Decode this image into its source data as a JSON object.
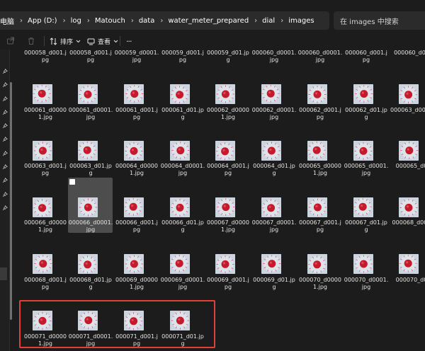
{
  "breadcrumb": [
    "电脑",
    "App (D:)",
    "log",
    "Matouch",
    "data",
    "water_meter_prepared",
    "dial",
    "images"
  ],
  "search_placeholder": "在 images 中搜索",
  "toolbar": {
    "sort_label": "排序",
    "view_label": "查看",
    "more_label": "···"
  },
  "icons": {
    "nav": "chevron-right-icon",
    "share": "share-icon",
    "delete": "trash-icon",
    "sort": "sort-icon",
    "view": "view-icon",
    "pin": "pin-icon"
  },
  "colors": {
    "background": "#1c1c1c",
    "highlight": "#e0403a",
    "thumb_bg": "#cbd4df",
    "dial_red": "#c41a2b"
  },
  "files": {
    "row0": [
      "000058_d001.jpg",
      "000058_d001.jpg",
      "000059_d0001.jpg",
      "000059_d001.jpg",
      "000059_d01.jpg",
      "000060_d0001.jpg",
      "000060_d0001.jpg",
      "000060_d001.jpg",
      "000060_d01"
    ],
    "row1": [
      "000061_d00001.jpg",
      "000061_d0001.jpg",
      "000061_d001.jpg",
      "000061_d01.jpg",
      "000062_d00001.jpg",
      "000062_d0001.jpg",
      "000062_d001.jpg",
      "000062_d01.jpg",
      "000063_d0000"
    ],
    "row2": [
      "000063_d001.jpg",
      "000063_d01.jpg",
      "000064_d00001.jpg",
      "000064_d0001.jpg",
      "000064_d001.jpg",
      "000064_d01.jpg",
      "000065_d00001.jpg",
      "000065_d0001.jpg",
      "000065_d0"
    ],
    "row3": [
      "000066_d00001.jpg",
      "000066_d0001.jpg",
      "000066_d001.jpg",
      "000066_d01.jpg",
      "000067_d00001.jpg",
      "000067_d0001.jpg",
      "000067_d001.jpg",
      "000067_d01.jpg",
      "000068_d000"
    ],
    "row4": [
      "000068_d001.jpg",
      "000068_d01.jpg",
      "000069_d00001.jpg",
      "000069_d0001.jpg",
      "000069_d001.jpg",
      "000069_d01.jpg",
      "000070_d00001.jpg",
      "000070_d0001.jpg",
      "000070_d0"
    ],
    "row5": [
      "000071_d00001.jpg",
      "000071_d0001.jpg",
      "000071_d001.jpg",
      "000071_d01.jpg"
    ]
  },
  "selected_file": "000066_d0001.jpg"
}
